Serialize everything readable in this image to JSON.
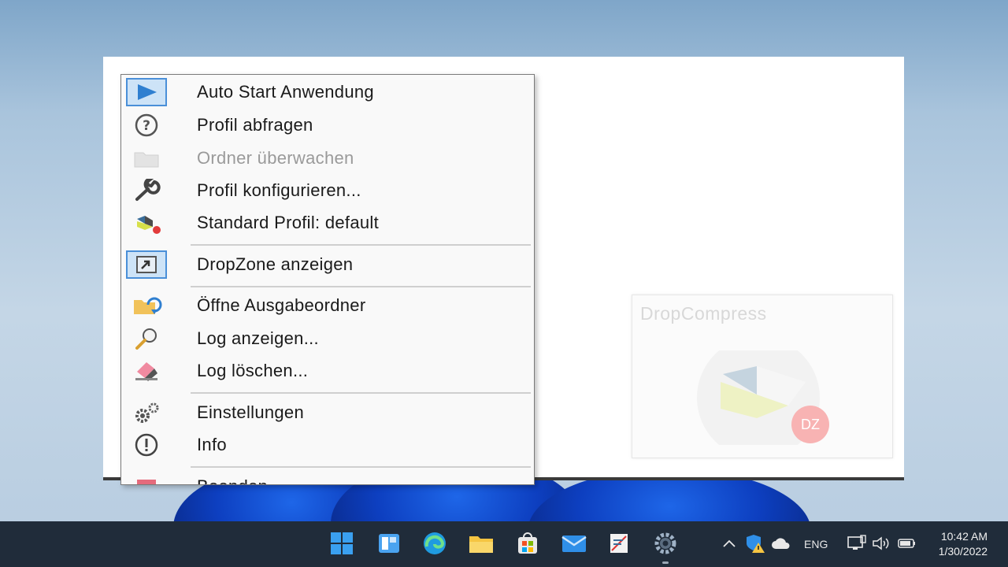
{
  "menu": {
    "items": [
      {
        "label": "Auto Start Anwendung",
        "icon": "play-icon",
        "selected": true,
        "disabled": false
      },
      {
        "label": "Profil abfragen",
        "icon": "question-icon",
        "selected": false,
        "disabled": false
      },
      {
        "label": "Ordner überwachen",
        "icon": "folder-icon",
        "selected": false,
        "disabled": true
      },
      {
        "label": "Profil konfigurieren...",
        "icon": "wrench-icon",
        "selected": false,
        "disabled": false
      },
      {
        "label": "Standard Profil: default",
        "icon": "profile-logo-icon",
        "selected": false,
        "disabled": false
      },
      {
        "label": "DropZone anzeigen",
        "icon": "window-arrow-icon",
        "selected": true,
        "disabled": false
      },
      {
        "label": "Öffne Ausgabeordner",
        "icon": "open-folder-icon",
        "selected": false,
        "disabled": false
      },
      {
        "label": "Log anzeigen...",
        "icon": "magnifier-icon",
        "selected": false,
        "disabled": false
      },
      {
        "label": "Log löschen...",
        "icon": "eraser-icon",
        "selected": false,
        "disabled": false
      },
      {
        "label": "Einstellungen",
        "icon": "gears-icon",
        "selected": false,
        "disabled": false
      },
      {
        "label": "Info",
        "icon": "exclamation-icon",
        "selected": false,
        "disabled": false
      },
      {
        "label": "Beenden",
        "icon": "exit-icon",
        "selected": false,
        "disabled": false
      }
    ]
  },
  "dropzone": {
    "title": "DropCompress",
    "badge": "DZ"
  },
  "taskbar": {
    "apps": [
      "windows-start-icon",
      "widgets-icon",
      "edge-icon",
      "file-explorer-icon",
      "store-icon",
      "mail-icon",
      "dropcompress-app-icon",
      "settings-icon"
    ],
    "language": "ENG",
    "time": "10:42 AM",
    "date": "1/30/2022"
  },
  "colors": {
    "accent": "#4a8fd8",
    "taskbar": "#202c3a",
    "badge": "#f25c5c"
  }
}
